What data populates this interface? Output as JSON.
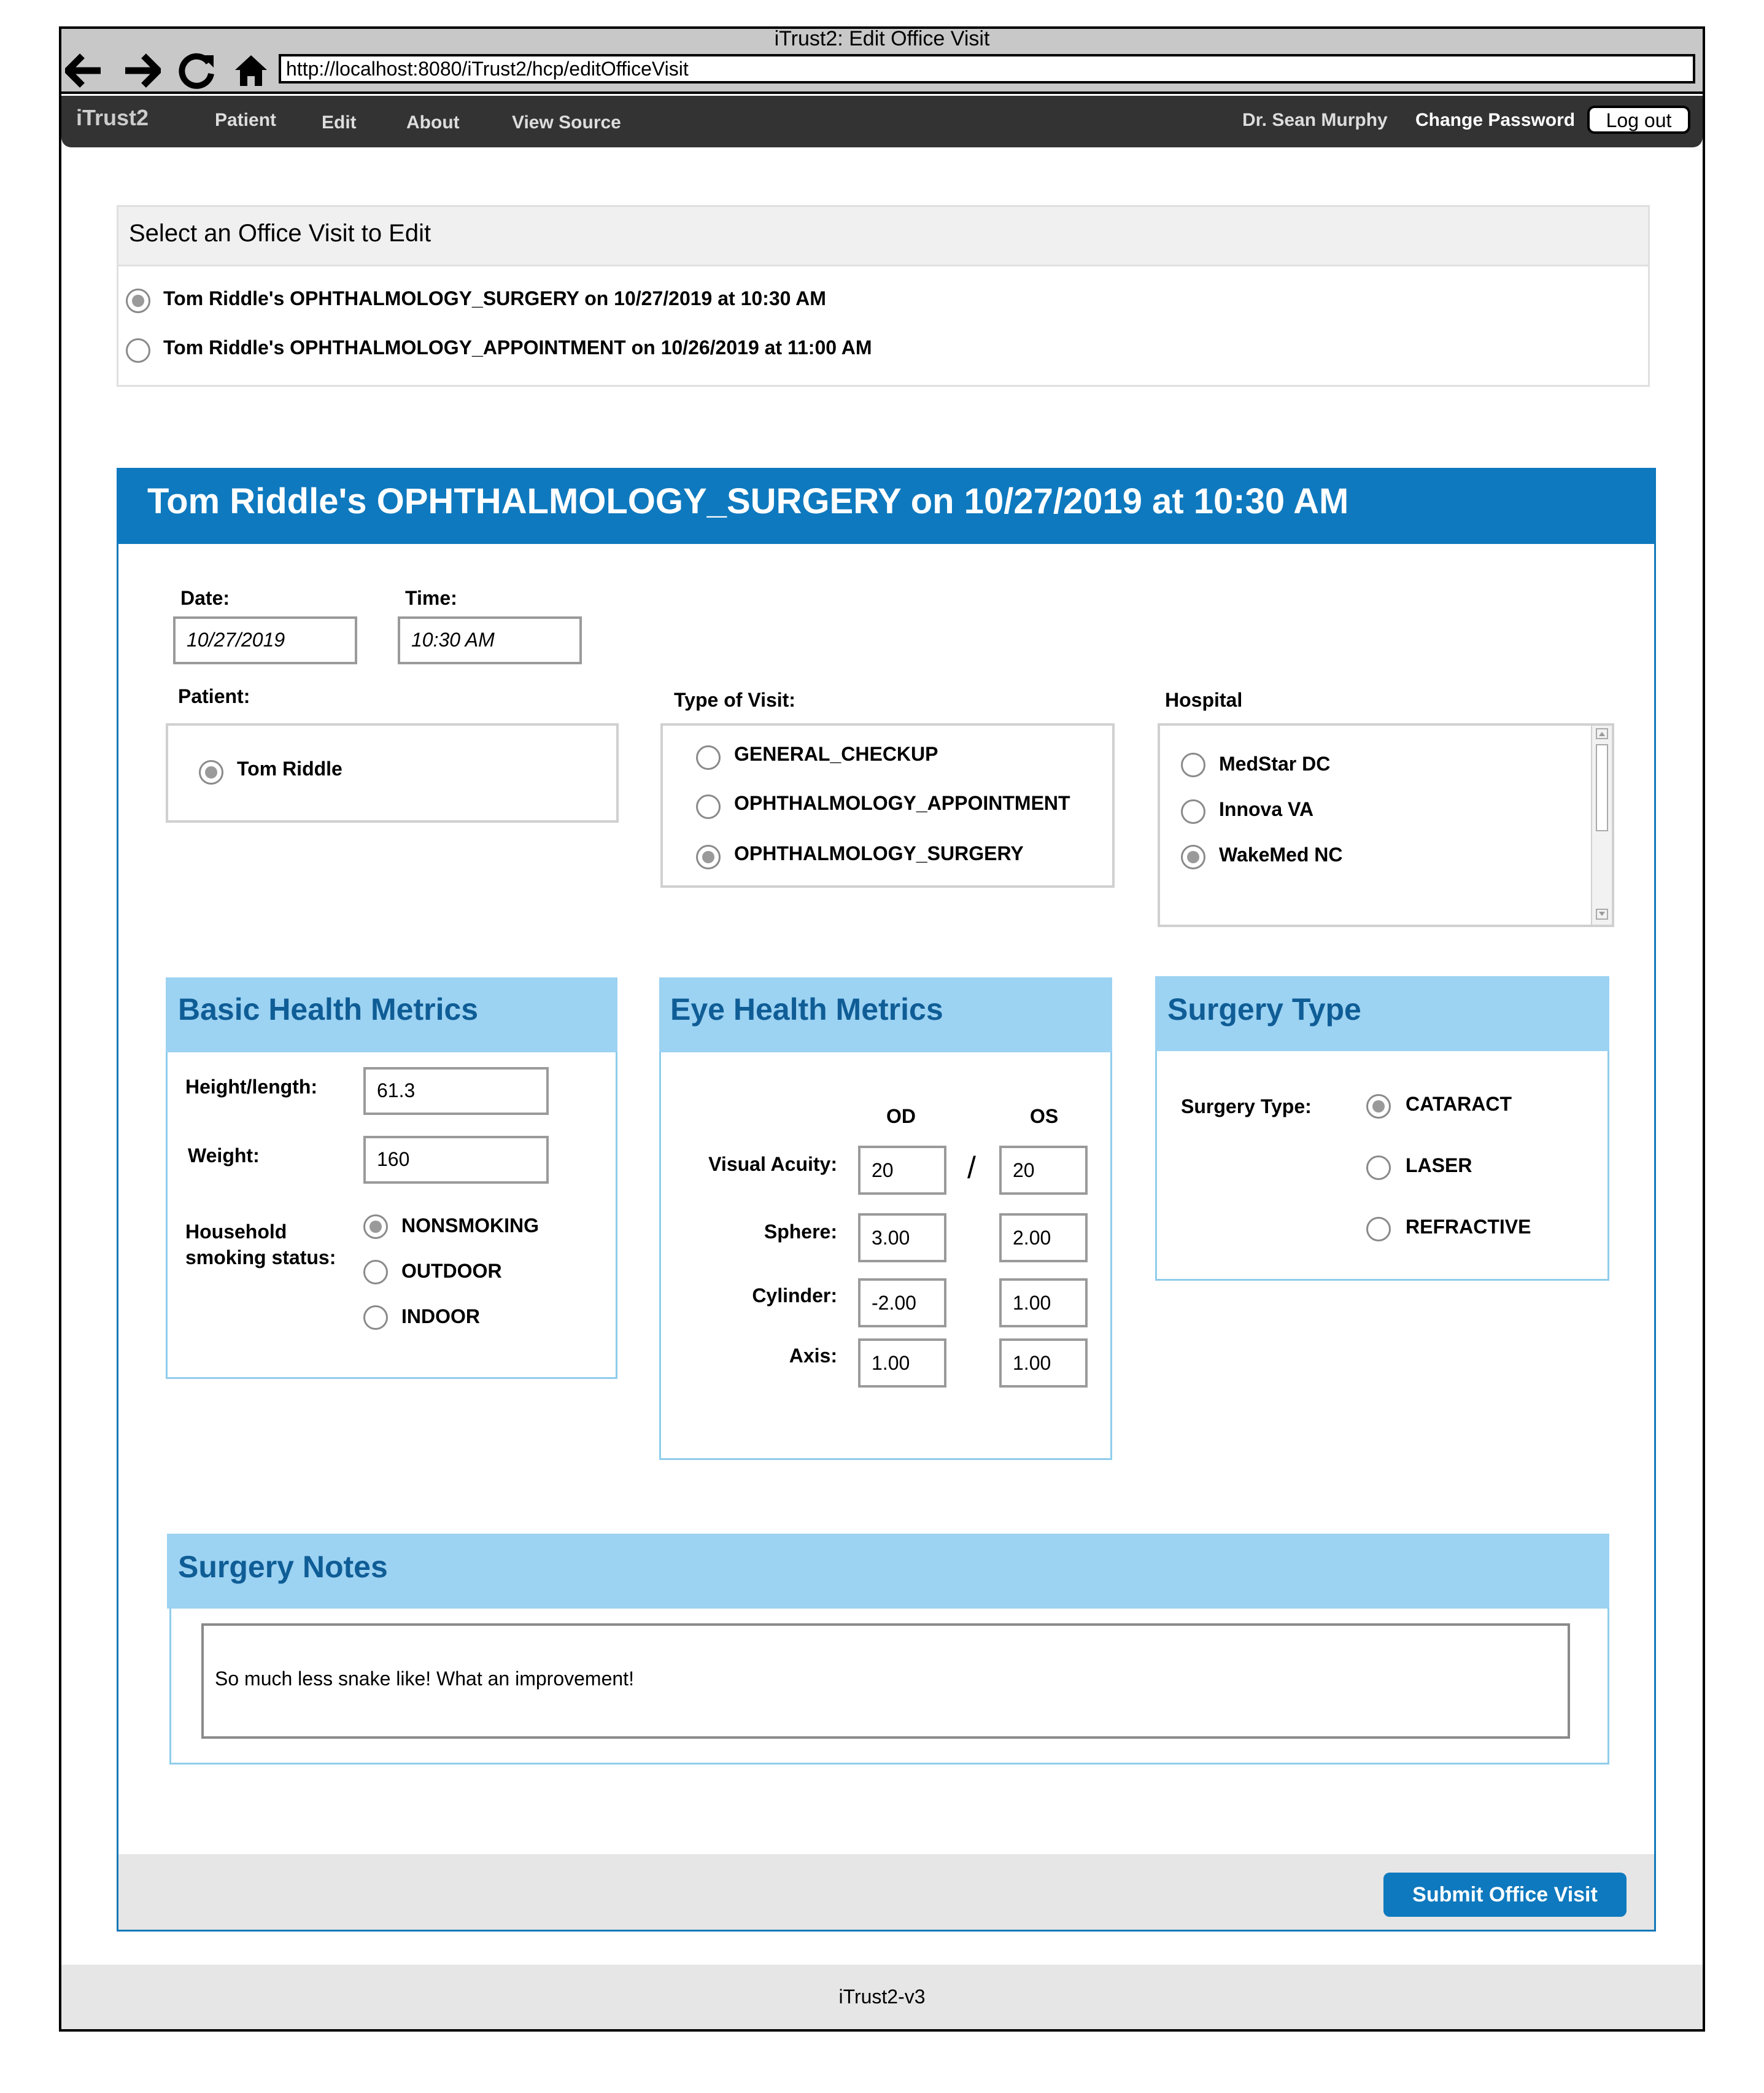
{
  "browser": {
    "window_title": "iTrust2: Edit Office Visit",
    "url": "http://localhost:8080/iTrust2/hcp/editOfficeVisit"
  },
  "nav": {
    "brand": "iTrust2",
    "items": [
      "Patient",
      "Edit",
      "About",
      "View Source"
    ],
    "user": "Dr. Sean Murphy",
    "change_password": "Change Password",
    "logout": "Log out"
  },
  "select_visit": {
    "title": "Select an Office Visit to Edit",
    "options": [
      {
        "label": "Tom Riddle's OPHTHALMOLOGY_SURGERY on 10/27/2019 at 10:30 AM",
        "selected": true
      },
      {
        "label": "Tom Riddle's OPHTHALMOLOGY_APPOINTMENT on 10/26/2019 at 11:00 AM",
        "selected": false
      }
    ]
  },
  "visit": {
    "title": "Tom Riddle's OPHTHALMOLOGY_SURGERY on 10/27/2019 at 10:30 AM",
    "date_label": "Date:",
    "date_value": "10/27/2019",
    "time_label": "Time:",
    "time_value": "10:30 AM",
    "patient_label": "Patient:",
    "patients": [
      {
        "label": "Tom Riddle",
        "selected": true
      }
    ],
    "type_label": "Type of Visit:",
    "types": [
      {
        "label": "GENERAL_CHECKUP",
        "selected": false
      },
      {
        "label": "OPHTHALMOLOGY_APPOINTMENT",
        "selected": false
      },
      {
        "label": "OPHTHALMOLOGY_SURGERY",
        "selected": true
      }
    ],
    "hospital_label": "Hospital",
    "hospitals": [
      {
        "label": "MedStar DC",
        "selected": false
      },
      {
        "label": "Innova VA",
        "selected": false
      },
      {
        "label": "WakeMed NC",
        "selected": true
      }
    ]
  },
  "basic_metrics": {
    "title": "Basic Health Metrics",
    "height_label": "Height/length:",
    "height_value": "61.3",
    "weight_label": "Weight:",
    "weight_value": "160",
    "smoking_label_1": "Household",
    "smoking_label_2": "smoking status:",
    "smoking_options": [
      {
        "label": "NONSMOKING",
        "selected": true
      },
      {
        "label": "OUTDOOR",
        "selected": false
      },
      {
        "label": "INDOOR",
        "selected": false
      }
    ]
  },
  "eye_metrics": {
    "title": "Eye Health Metrics",
    "od_label": "OD",
    "os_label": "OS",
    "separator": "/",
    "rows": [
      {
        "label": "Visual Acuity:",
        "od": "20",
        "os": "20"
      },
      {
        "label": "Sphere:",
        "od": "3.00",
        "os": "2.00"
      },
      {
        "label": "Cylinder:",
        "od": "-2.00",
        "os": "1.00"
      },
      {
        "label": "Axis:",
        "od": "1.00",
        "os": "1.00"
      }
    ]
  },
  "surgery_type": {
    "title": "Surgery Type",
    "label": "Surgery Type:",
    "options": [
      {
        "label": "CATARACT",
        "selected": true
      },
      {
        "label": "LASER",
        "selected": false
      },
      {
        "label": "REFRACTIVE",
        "selected": false
      }
    ]
  },
  "surgery_notes": {
    "title": "Surgery Notes",
    "text": "So much less snake like! What an improvement!"
  },
  "submit_label": "Submit Office Visit",
  "footer": "iTrust2-v3",
  "colors": {
    "header_blue": "#0e79be",
    "section_light_blue": "#9cd2f2",
    "section_title_blue": "#0f5d96",
    "navbar_dark": "#333333"
  }
}
